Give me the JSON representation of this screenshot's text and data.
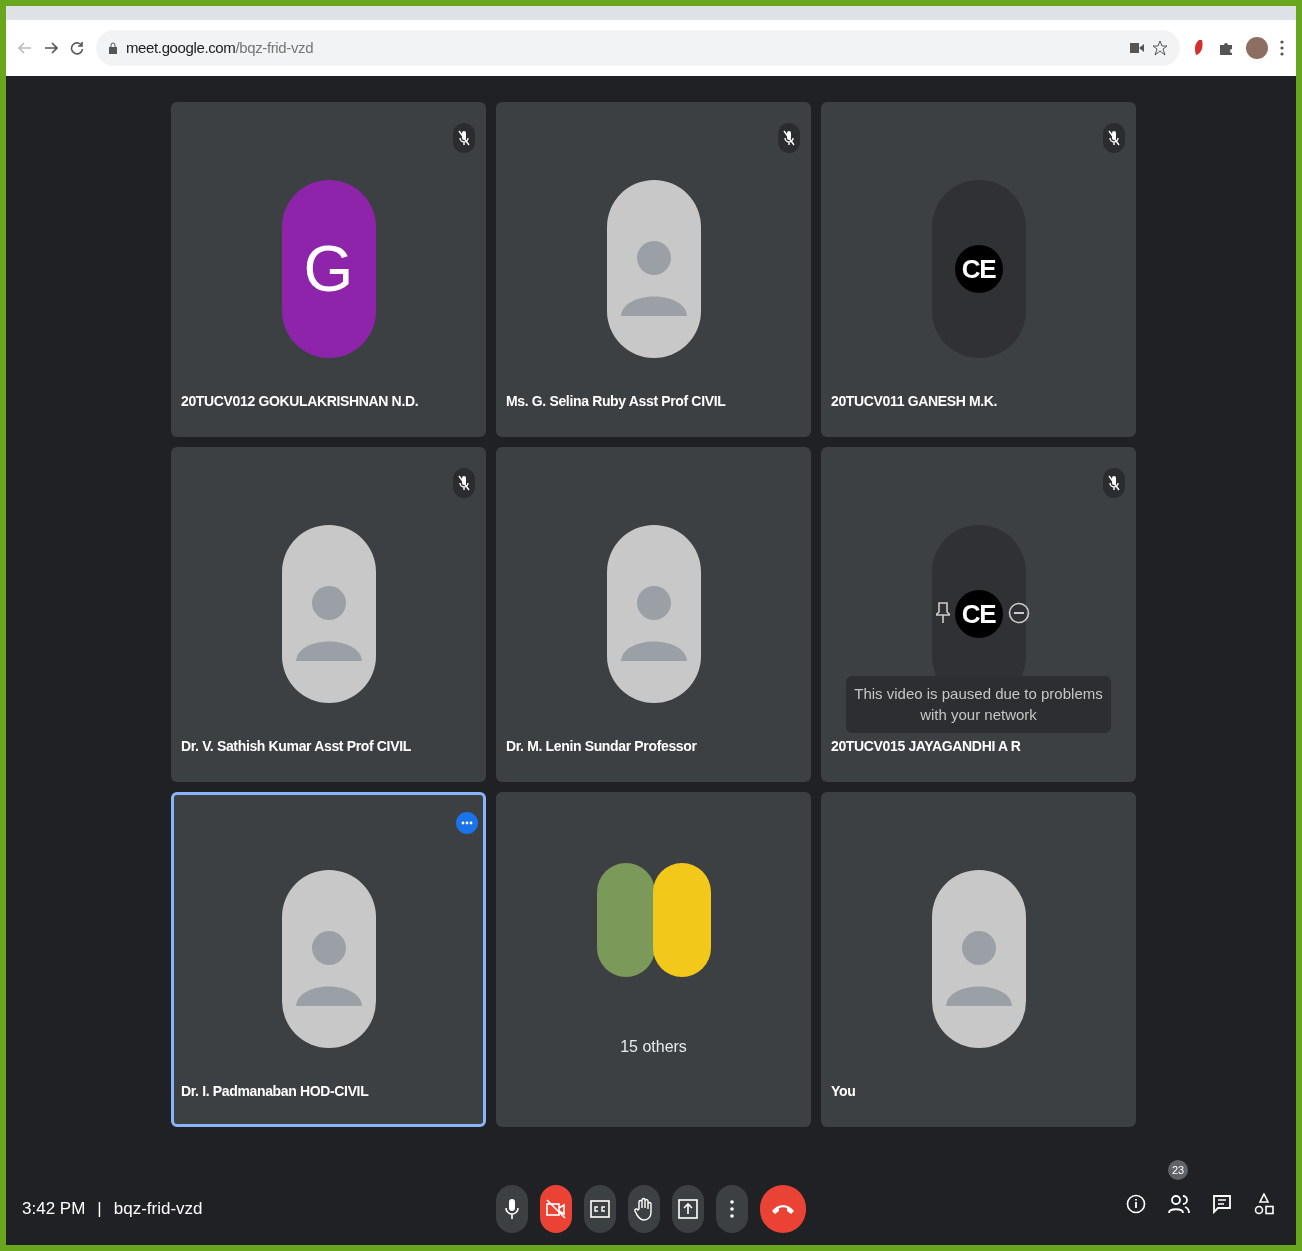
{
  "browser": {
    "url_host": "meet.google.com",
    "url_path": "/bqz-frid-vzd"
  },
  "tiles": [
    {
      "name": "20TUCV012 GOKULAKRISHNAN N.D.",
      "muted": true,
      "selected": false,
      "avatar": {
        "kind": "letter",
        "text": "G",
        "color": "#8e24aa"
      }
    },
    {
      "name": "Ms. G. Selina Ruby Asst Prof CIVIL",
      "muted": true,
      "selected": false,
      "avatar": {
        "kind": "photo"
      }
    },
    {
      "name": "20TUCV011 GANESH M.K.",
      "muted": true,
      "selected": false,
      "avatar": {
        "kind": "logo",
        "text": "CE"
      }
    },
    {
      "name": "Dr. V. Sathish Kumar Asst Prof CIVIL",
      "muted": true,
      "selected": false,
      "avatar": {
        "kind": "photo"
      }
    },
    {
      "name": "Dr. M. Lenin Sundar Professor",
      "muted": false,
      "selected": false,
      "avatar": {
        "kind": "photo"
      }
    },
    {
      "name": "20TUCV015 JAYAGANDHI A R",
      "muted": true,
      "selected": false,
      "avatar": {
        "kind": "logo",
        "text": "CE"
      },
      "hover_controls": true,
      "notice": "This video is paused due to problems with your network"
    },
    {
      "name": "Dr. I. Padmanaban HOD-CIVIL",
      "muted": false,
      "selected": true,
      "avatar": {
        "kind": "photo"
      }
    },
    {
      "name": "15 others",
      "muted": false,
      "selected": false,
      "avatar": {
        "kind": "group"
      }
    },
    {
      "name": "You",
      "muted": false,
      "selected": false,
      "avatar": {
        "kind": "photo"
      }
    }
  ],
  "bottom_bar": {
    "time": "3:42 PM",
    "separator": "|",
    "meeting_code": "bqz-frid-vzd",
    "controls": [
      {
        "kind": "mic",
        "off": false
      },
      {
        "kind": "camera",
        "off": true
      },
      {
        "kind": "captions",
        "off": false
      },
      {
        "kind": "hand",
        "off": false
      },
      {
        "kind": "present",
        "off": false
      },
      {
        "kind": "more",
        "off": false
      },
      {
        "kind": "end",
        "off": true
      }
    ],
    "participants_count": "23"
  }
}
